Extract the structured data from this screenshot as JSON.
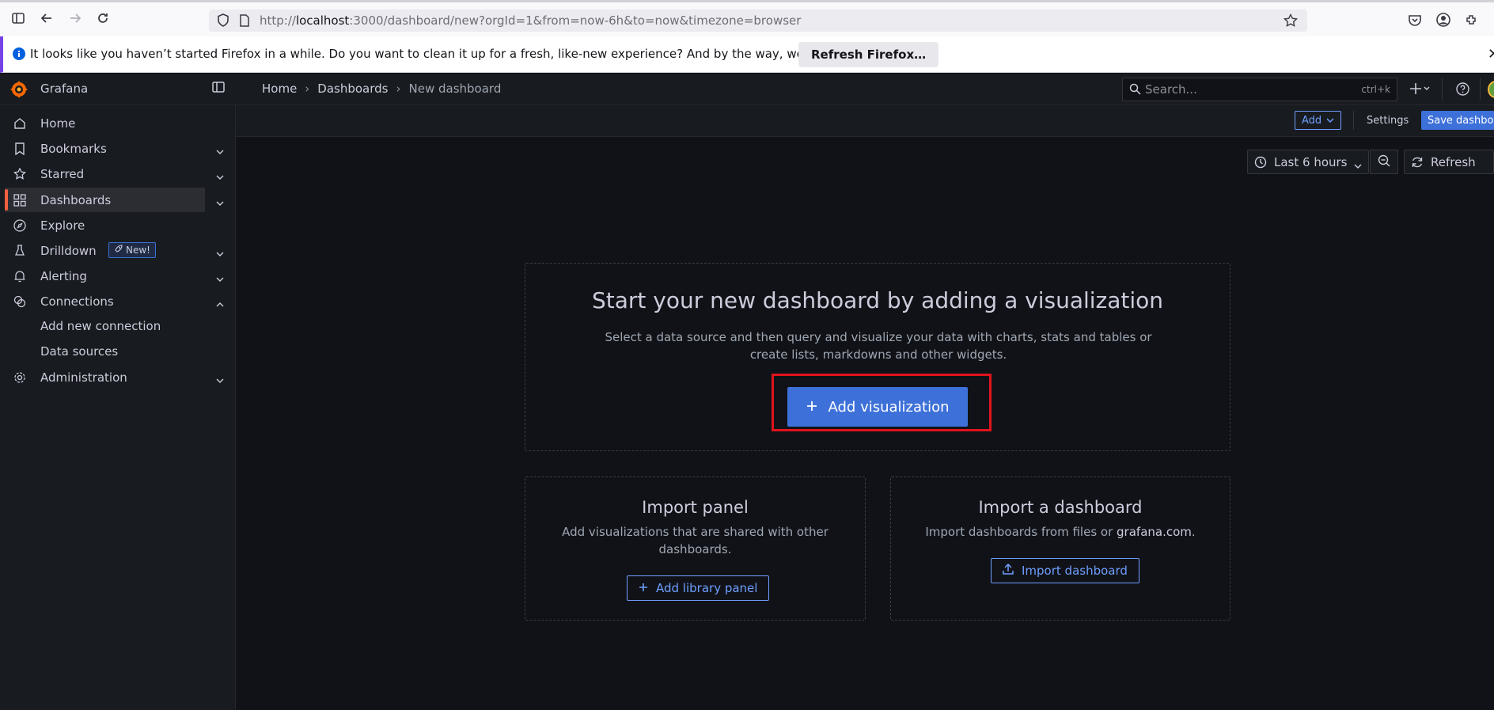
{
  "browser": {
    "url_prefix": "http://",
    "url_host": "localhost",
    "url_rest": ":3000/dashboard/new?orgId=1&from=now-6h&to=now&timezone=browser"
  },
  "notification": {
    "message": "It looks like you haven’t started Firefox in a while. Do you want to clean it up for a fresh, like-new experience? And by the way, welcome back!",
    "button_label": "Refresh Firefox…"
  },
  "topbar": {
    "brand": "Grafana",
    "breadcrumbs": [
      "Home",
      "Dashboards",
      "New dashboard"
    ],
    "search_placeholder": "Search...",
    "search_shortcut": "ctrl+k"
  },
  "toolbar": {
    "add_label": "Add",
    "settings_label": "Settings",
    "save_label": "Save dashboard"
  },
  "sidebar": {
    "items": [
      {
        "label": "Home"
      },
      {
        "label": "Bookmarks"
      },
      {
        "label": "Starred"
      },
      {
        "label": "Dashboards"
      },
      {
        "label": "Explore"
      },
      {
        "label": "Drilldown",
        "badge": "New!"
      },
      {
        "label": "Alerting"
      },
      {
        "label": "Connections"
      },
      {
        "label": "Administration"
      }
    ],
    "sub_items": [
      "Add new connection",
      "Data sources"
    ]
  },
  "controls": {
    "time_range": "Last 6 hours",
    "refresh_label": "Refresh"
  },
  "main": {
    "title": "Start your new dashboard by adding a visualization",
    "description": "Select a data source and then query and visualize your data with charts, stats and tables or create lists, markdowns and other widgets.",
    "add_visualization_label": "Add visualization"
  },
  "import_panel": {
    "title": "Import panel",
    "description": "Add visualizations that are shared with other dashboards.",
    "button_label": "Add library panel"
  },
  "import_dashboard": {
    "title": "Import a dashboard",
    "description_prefix": "Import dashboards from files or ",
    "link_text": "grafana.com",
    "description_suffix": ".",
    "button_label": "Import dashboard"
  },
  "colors": {
    "primary": "#3d71d9",
    "accent_orange": "#f55f3e",
    "highlight_red": "#e0131d",
    "background": "#111217"
  }
}
